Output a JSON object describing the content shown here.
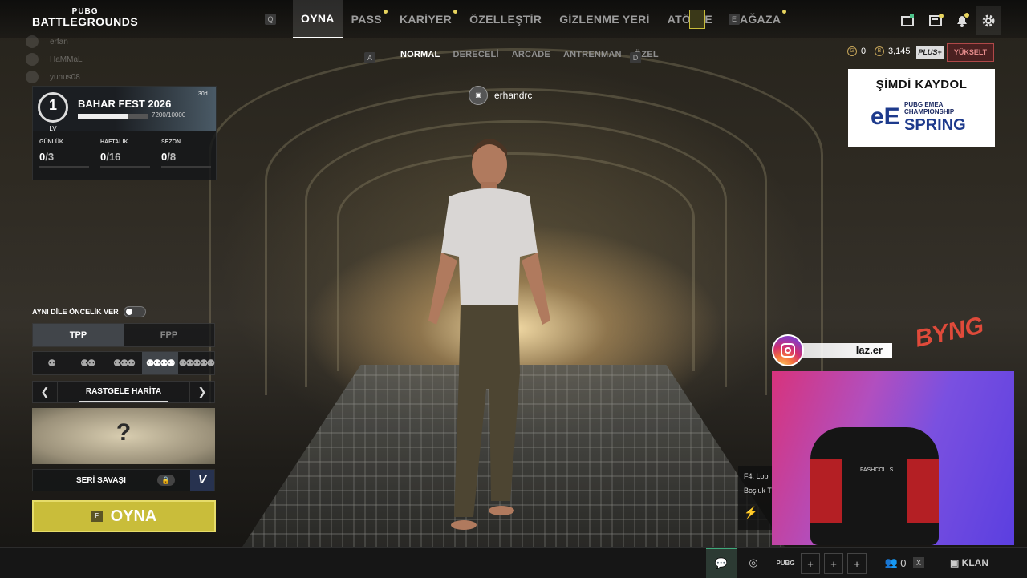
{
  "logo": {
    "line1": "PUBG",
    "line2": "BATTLEGROUNDS"
  },
  "nav": {
    "key_left": "Q",
    "key_right": "E",
    "items": [
      {
        "label": "OYNA",
        "active": true,
        "dot": false
      },
      {
        "label": "PASS",
        "active": false,
        "dot": true
      },
      {
        "label": "KARİYER",
        "active": false,
        "dot": true
      },
      {
        "label": "ÖZELLEŞTİR",
        "active": false,
        "dot": false
      },
      {
        "label": "GİZLENME YERİ",
        "active": false,
        "dot": false
      },
      {
        "label": "ATÖLYE",
        "active": false,
        "dot": false
      },
      {
        "label": "MAĞAZA",
        "active": false,
        "dot": true
      }
    ],
    "icons": [
      "store-bag-icon",
      "news-icon",
      "bell-icon",
      "settings-gear-icon"
    ]
  },
  "modes": {
    "key_left": "A",
    "key_right": "D",
    "items": [
      {
        "label": "NORMAL",
        "active": true
      },
      {
        "label": "DERECELİ",
        "active": false
      },
      {
        "label": "ARCADE",
        "active": false
      },
      {
        "label": "ANTRENMAN",
        "active": false
      },
      {
        "label": "ÖZEL",
        "active": false
      }
    ]
  },
  "friends": [
    "erfan",
    "HaMMaL",
    "yunus08"
  ],
  "event": {
    "level": "1",
    "level_label": "LV",
    "title": "BAHAR FEST 2026",
    "xp_text": "7200/10000",
    "xp_fraction": 0.72,
    "days": "30d",
    "stats": [
      {
        "label": "GÜNLÜK",
        "current": "0",
        "total": "/3"
      },
      {
        "label": "HAFTALIK",
        "current": "0",
        "total": "/16"
      },
      {
        "label": "SEZON",
        "current": "0",
        "total": "/8"
      }
    ]
  },
  "language_priority": {
    "label": "AYNI DİLE ÖNCELİK VER",
    "enabled": false
  },
  "perspective": {
    "options": [
      "TPP",
      "FPP"
    ],
    "selected": "TPP"
  },
  "squad": {
    "options": [
      "solo",
      "duo",
      "trio",
      "squad",
      "five"
    ],
    "selected_index": 3
  },
  "map": {
    "name": "RASTGELE HARİTA",
    "unknown_symbol": "?"
  },
  "seri": {
    "label": "SERİ SAVAŞI",
    "v_label": "V"
  },
  "play_button": {
    "key": "F",
    "label": "OYNA"
  },
  "player": {
    "name": "erhandrc"
  },
  "currency": {
    "g_coin": "0",
    "bp": "3,145",
    "plus_label": "PLUS+",
    "upgrade_label": "YÜKSELT"
  },
  "ad": {
    "headline": "ŞİMDİ KAYDOL",
    "line1": "PUBG EMEA",
    "line2": "CHAMPIONSHIP",
    "season": "SPRING"
  },
  "stream": {
    "handle": "laz.er",
    "brand": "BYNG"
  },
  "console": {
    "line1": "F4: Lobi",
    "line2": "Boşluk T"
  },
  "bottom": {
    "friends_count": "0",
    "clan_label": "KLAN"
  }
}
